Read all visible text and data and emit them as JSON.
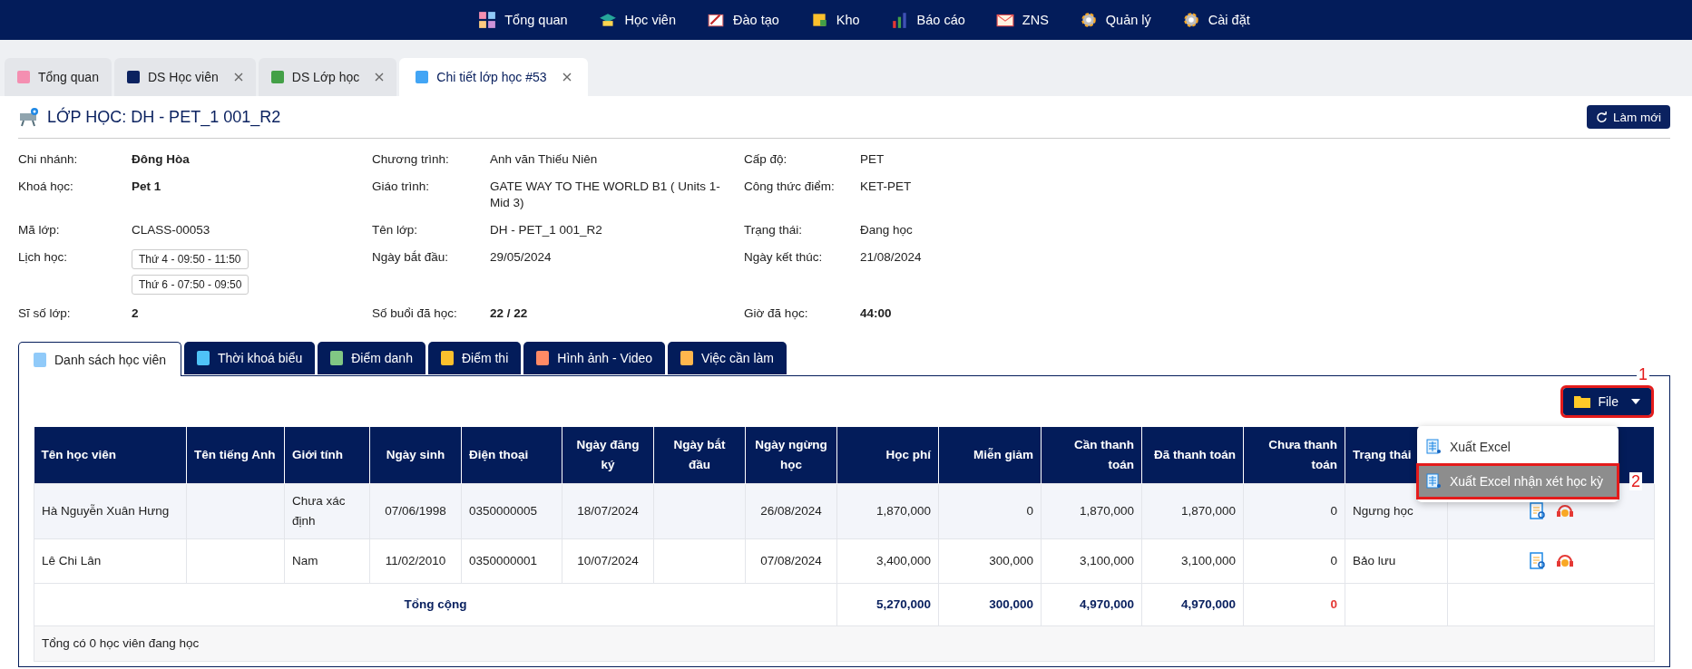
{
  "nav": [
    {
      "label": "Tổng quan"
    },
    {
      "label": "Học viên"
    },
    {
      "label": "Đào tạo"
    },
    {
      "label": "Kho"
    },
    {
      "label": "Báo cáo"
    },
    {
      "label": "ZNS"
    },
    {
      "label": "Quản lý"
    },
    {
      "label": "Cài đặt"
    }
  ],
  "page_tabs": [
    {
      "label": "Tổng quan",
      "selected": false,
      "closable": false
    },
    {
      "label": "DS Học viên",
      "selected": false,
      "closable": true
    },
    {
      "label": "DS Lớp học",
      "selected": false,
      "closable": true
    },
    {
      "label": "Chi tiết lớp học #53",
      "selected": true,
      "closable": true
    }
  ],
  "title": "LỚP HỌC: DH - PET_1 001_R2",
  "refresh_button": "Làm mới",
  "details": [
    [
      {
        "label": "Chi nhánh:",
        "value": "Đông Hòa",
        "bold": true
      },
      {
        "label": "Chương trình:",
        "value": "Anh văn Thiếu Niên",
        "bold": false
      },
      {
        "label": "Cấp độ:",
        "value": "PET",
        "bold": false
      }
    ],
    [
      {
        "label": "Khoá học:",
        "value": "Pet 1",
        "bold": true
      },
      {
        "label": "Giáo trình:",
        "value": "GATE WAY TO THE WORLD B1 ( Units 1-Mid 3)",
        "bold": false
      },
      {
        "label": "Công thức điểm:",
        "value": "KET-PET",
        "bold": false
      }
    ],
    [
      {
        "label": "Mã lớp:",
        "value": "CLASS-00053",
        "bold": false
      },
      {
        "label": "Tên lớp:",
        "value": "DH - PET_1 001_R2",
        "bold": false
      },
      {
        "label": "Trạng thái:",
        "value": "Đang học",
        "bold": false
      }
    ],
    [
      {
        "label": "Lịch học:",
        "schedule": [
          "Thứ 4 - 09:50 - 11:50",
          "Thứ 6 - 07:50 - 09:50"
        ]
      },
      {
        "label": "Ngày bắt đầu:",
        "value": "29/05/2024",
        "bold": false
      },
      {
        "label": "Ngày kết thúc:",
        "value": "21/08/2024",
        "bold": false
      }
    ],
    [
      {
        "label": "Sĩ số lớp:",
        "value": "2",
        "bold": true
      },
      {
        "label": "Số buổi đã học:",
        "value": "22 / 22",
        "bold": true
      },
      {
        "label": "Giờ đã học:",
        "value": "44:00",
        "bold": true
      }
    ]
  ],
  "section_tabs": [
    {
      "label": "Danh sách học viên",
      "selected": true
    },
    {
      "label": "Thời khoá biểu",
      "selected": false
    },
    {
      "label": "Điểm danh",
      "selected": false
    },
    {
      "label": "Điểm thi",
      "selected": false
    },
    {
      "label": "Hình ảnh - Video",
      "selected": false
    },
    {
      "label": "Việc cần làm",
      "selected": false
    }
  ],
  "file_button": {
    "label": "File",
    "marked": true,
    "marker": "1"
  },
  "file_menu": [
    {
      "label": "Xuất Excel",
      "highlighted": false,
      "marked": false
    },
    {
      "label": "Xuất Excel nhận xét học kỳ",
      "highlighted": true,
      "marked": true,
      "marker": "2"
    }
  ],
  "table": {
    "columns": [
      "Tên học viên",
      "Tên tiếng Anh",
      "Giới tính",
      "Ngày sinh",
      "Điện thoại",
      "Ngày đăng ký",
      "Ngày bắt đầu",
      "Ngày ngừng học",
      "Học phí",
      "Miễn giảm",
      "Cần thanh toán",
      "Đã thanh toán",
      "Chưa thanh toán",
      "Trạng thái"
    ],
    "rows": [
      {
        "cells": [
          "Hà Nguyễn Xuân Hưng",
          null,
          "Chưa xác định",
          "07/06/1998",
          "0350000005",
          "18/07/2024",
          null,
          "26/08/2024",
          "1,870,000",
          "0",
          "1,870,000",
          "1,870,000",
          "0",
          "Ngưng học"
        ]
      },
      {
        "cells": [
          "Lê Chi Lân",
          null,
          "Nam",
          "11/02/2010",
          "0350000001",
          "10/07/2024",
          null,
          "07/08/2024",
          "3,400,000",
          "300,000",
          "3,100,000",
          "3,100,000",
          "0",
          "Bảo lưu"
        ]
      }
    ],
    "total_label": "Tổng cộng",
    "totals": [
      {
        "value": "5,270,000",
        "color": "#0b2260"
      },
      {
        "value": "300,000",
        "color": "#0b2260"
      },
      {
        "value": "4,970,000",
        "color": "#0b2260"
      },
      {
        "value": "4,970,000",
        "color": "#0b2260"
      },
      {
        "value": "0",
        "color": "#e53935"
      }
    ],
    "footer": "Tổng có 0 học viên đang học"
  }
}
